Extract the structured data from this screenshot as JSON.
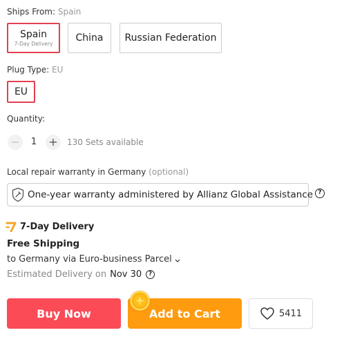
{
  "ships_from": {
    "label": "Ships From:",
    "value": "Spain",
    "options": [
      {
        "name": "Spain",
        "sub": "7-Day Delivery"
      },
      {
        "name": "China"
      },
      {
        "name": "Russian Federation"
      }
    ]
  },
  "plug_type": {
    "label": "Plug Type:",
    "value": "EU",
    "options": [
      {
        "name": "EU"
      }
    ]
  },
  "quantity": {
    "label": "Quantity:",
    "value": "1",
    "minus": "−",
    "plus": "+",
    "available": "130 Sets available"
  },
  "warranty": {
    "label": "Local repair warranty in Germany",
    "optional": "(optional)",
    "option_text": "One-year warranty administered by Allianz Global Assistance",
    "help": "?"
  },
  "delivery": {
    "badge": "7-Day Delivery",
    "shipping_title": "Free Shipping",
    "shipping_detail": "to Germany via Euro-business Parcel",
    "estimated_label": "Estimated Delivery on",
    "estimated_date": "Nov 30",
    "help": "?"
  },
  "actions": {
    "buy_now": "Buy Now",
    "add_to_cart": "Add to Cart",
    "wishlist_count": "5411"
  },
  "colors": {
    "selected_border": "#e0404f",
    "buy_now_bg": "#fa4b57",
    "add_to_cart_bg": "#fe9b0e",
    "badge_orange": "#f5a623"
  }
}
